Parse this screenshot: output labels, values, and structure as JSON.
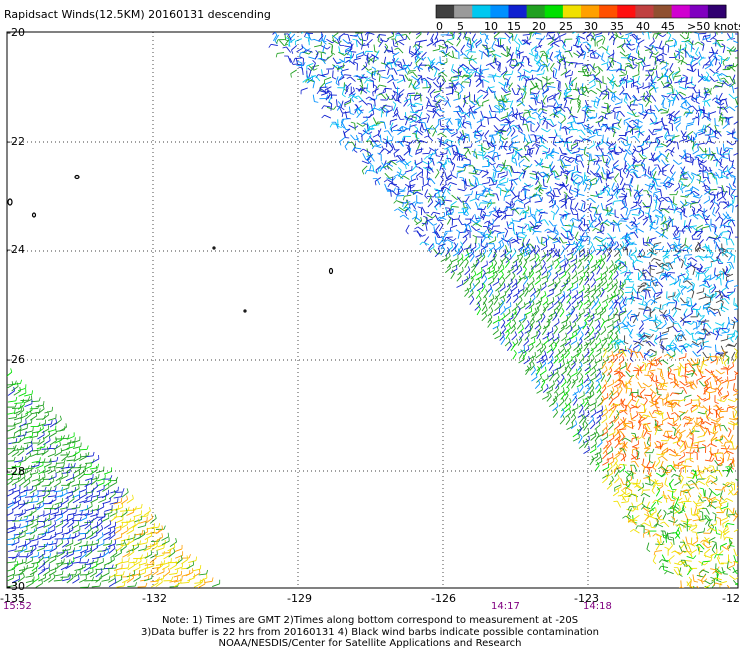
{
  "title": "Rapidsact Winds(12.5KM) 20160131 descending",
  "legend": {
    "colors": [
      "#404040",
      "#9a9a9a",
      "#00c8f0",
      "#0090ff",
      "#1020d0",
      "#20a020",
      "#00e000",
      "#f0e000",
      "#ffa000",
      "#ff5000",
      "#ff1010",
      "#c04040",
      "#905030",
      "#d000d0",
      "#8000c0",
      "#300070"
    ],
    "labels": [
      "0",
      "5",
      "10",
      "15",
      "20",
      "25",
      "30",
      "35",
      "40",
      "45",
      ">50 knots"
    ]
  },
  "axes": {
    "lat_labels": [
      "-20",
      "-22",
      "-24",
      "-26",
      "-28",
      "-30"
    ],
    "lon_labels": [
      "-135",
      "-132",
      "-129",
      "-126",
      "-123",
      "-12"
    ]
  },
  "time_labels": [
    "15:52",
    "14:17",
    "14:18"
  ],
  "notes": [
    "Note: 1) Times are GMT 2)Times along bottom correspond to measurement at -20S",
    "3)Data buffer is 22 hrs from 20160131 4) Black wind barbs indicate possible contamination",
    "NOAA/NESDIS/Center for Satellite Applications and Research"
  ]
}
